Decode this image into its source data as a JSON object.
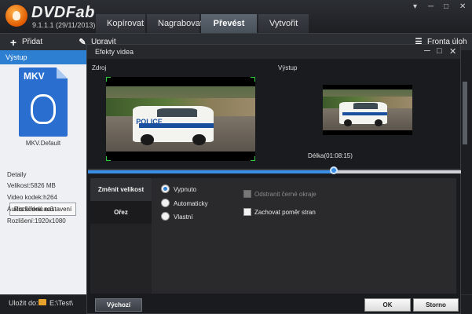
{
  "app": {
    "name": "DVDFab",
    "version": "9.1.1.1 (29/11/2013)"
  },
  "main_tabs": [
    "Kopírovat",
    "Nagrabovat",
    "Převést",
    "Vytvořit"
  ],
  "active_tab": "Převést",
  "toolbar": {
    "add_label": "Přidat",
    "edit_label": "Upravit",
    "queue_label": "Fronta úloh"
  },
  "left_panel": {
    "header": "Výstup",
    "format_badge": "MKV",
    "profile_name": "MKV.Default",
    "advanced_button": "Rozšířená nastavení",
    "details_heading": "Detaily",
    "size": "Velikost:5826 MB",
    "video_codec": "Video kodek:h264",
    "audio_codec": "Audio kodek:ac3",
    "resolution": "Rozlišení:1920x1080"
  },
  "bottom_bar": {
    "save_to_label": "Uložit do:",
    "save_path": "E:\\Test\\"
  },
  "dialog": {
    "title": "Efekty videa",
    "source_label": "Zdroj",
    "output_label": "Výstup",
    "duration": "Délka(01:08:15)",
    "playhead_fraction": 0.66,
    "preview_overlay_text": "POLICE",
    "menu_items": [
      "Změnit velikost",
      "Ořez"
    ],
    "active_menu": "Změnit velikost",
    "radio_options": [
      "Vypnuto",
      "Automaticky",
      "Vlastní"
    ],
    "selected_radio": "Vypnuto",
    "remove_black_borders": "Odstranit černé okraje",
    "keep_aspect_ratio": "Zachovat poměr stran",
    "defaults_button": "Výchozí",
    "ok_button": "OK",
    "cancel_button": "Storno"
  },
  "colors": {
    "accent": "#2d7fd1",
    "header_bar": "#2d7fd1",
    "selection_corners": "#2ecc40"
  }
}
